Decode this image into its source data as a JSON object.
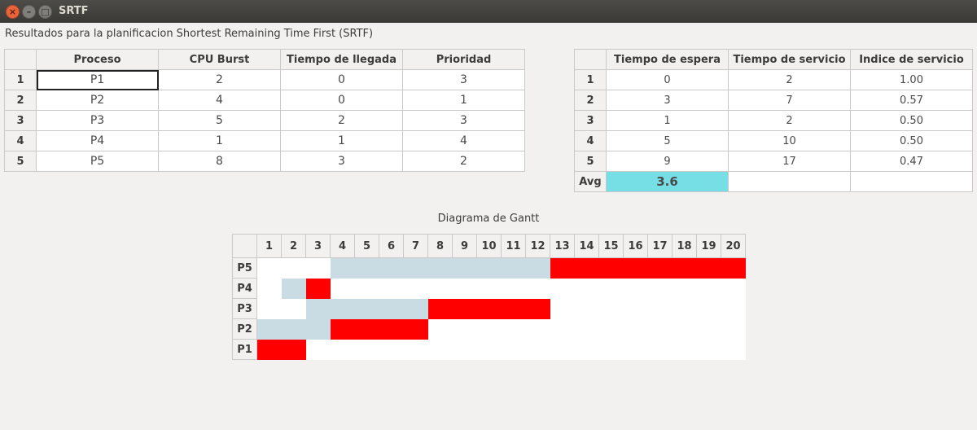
{
  "window": {
    "title": "SRTF"
  },
  "caption": "Resultados para la planificacion Shortest Remaining Time First (SRTF)",
  "process_table": {
    "headers": [
      "Proceso",
      "CPU Burst",
      "Tiempo de llegada",
      "Prioridad"
    ],
    "rows": [
      {
        "idx": "1",
        "cells": [
          "P1",
          "2",
          "0",
          "3"
        ]
      },
      {
        "idx": "2",
        "cells": [
          "P2",
          "4",
          "0",
          "1"
        ]
      },
      {
        "idx": "3",
        "cells": [
          "P3",
          "5",
          "2",
          "3"
        ]
      },
      {
        "idx": "4",
        "cells": [
          "P4",
          "1",
          "1",
          "4"
        ]
      },
      {
        "idx": "5",
        "cells": [
          "P5",
          "8",
          "3",
          "2"
        ]
      }
    ]
  },
  "results_table": {
    "headers": [
      "Tiempo de espera",
      "Tiempo de servicio",
      "Indice de servicio"
    ],
    "rows": [
      {
        "idx": "1",
        "cells": [
          "0",
          "2",
          "1.00"
        ]
      },
      {
        "idx": "2",
        "cells": [
          "3",
          "7",
          "0.57"
        ]
      },
      {
        "idx": "3",
        "cells": [
          "1",
          "2",
          "0.50"
        ]
      },
      {
        "idx": "4",
        "cells": [
          "5",
          "10",
          "0.50"
        ]
      },
      {
        "idx": "5",
        "cells": [
          "9",
          "17",
          "0.47"
        ]
      }
    ],
    "avg_label": "Avg",
    "avg_value": "3.6"
  },
  "gantt": {
    "title": "Diagrama de Gantt",
    "columns": [
      "1",
      "2",
      "3",
      "4",
      "5",
      "6",
      "7",
      "8",
      "9",
      "10",
      "11",
      "12",
      "13",
      "14",
      "15",
      "16",
      "17",
      "18",
      "19",
      "20"
    ],
    "rows": [
      {
        "label": "P5",
        "cells": "wwwqqqqqqqqqrrrrrrrr"
      },
      {
        "label": "P4",
        "cells": "wqrwwwwwwwwwwwwwwwww"
      },
      {
        "label": "P3",
        "cells": "wwqqqqqrrrrrwwwwwwww"
      },
      {
        "label": "P2",
        "cells": "qqqrrrrwwwwwwwwwwwww"
      },
      {
        "label": "P1",
        "cells": "rrwwwwwwwwwwwwwwwwww"
      }
    ],
    "colors": {
      "waiting": "#c9dbe3",
      "running": "#ff0000",
      "idle": "#ffffff"
    }
  }
}
